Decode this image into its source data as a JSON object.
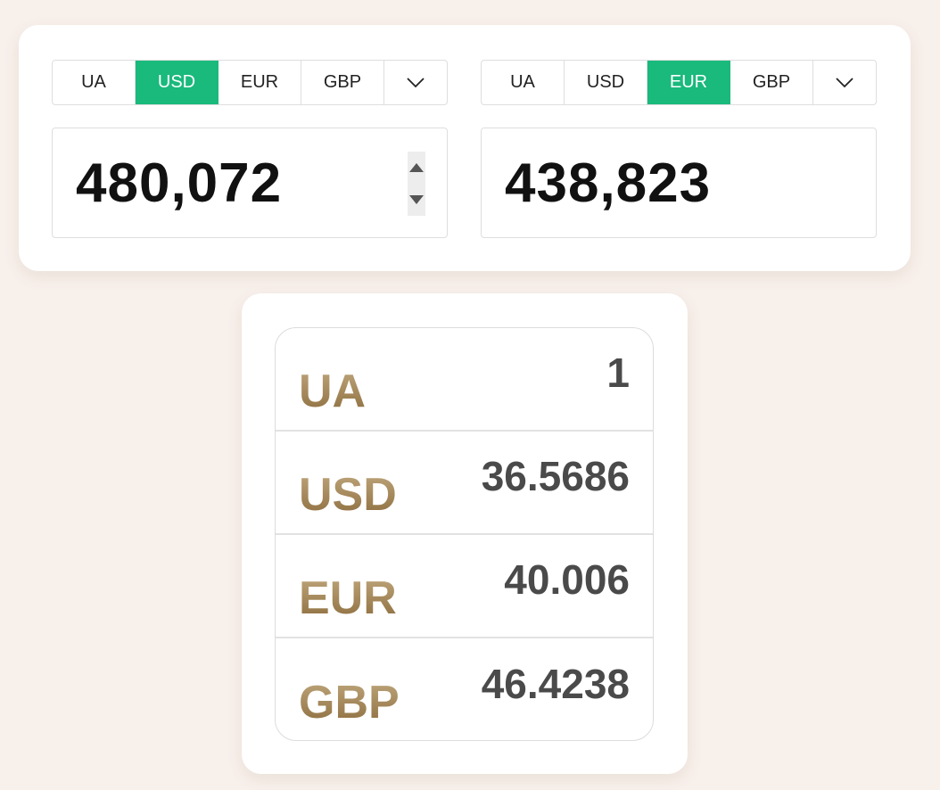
{
  "colors": {
    "page_background": "#f8f0eb",
    "card_background": "#ffffff",
    "accent": "#1ab97c",
    "rate_code_gradient": [
      "#c2aa80",
      "#8a6a3a"
    ],
    "rate_value": "#4a4a4a"
  },
  "converter": {
    "from": {
      "tabs": [
        "UA",
        "USD",
        "EUR",
        "GBP"
      ],
      "active_tab": "USD",
      "more_icon": "chevron-down-icon",
      "amount": "480,072"
    },
    "to": {
      "tabs": [
        "UA",
        "USD",
        "EUR",
        "GBP"
      ],
      "active_tab": "EUR",
      "more_icon": "chevron-down-icon",
      "amount": "438,823"
    }
  },
  "rates": [
    {
      "code": "UA",
      "value": "1"
    },
    {
      "code": "USD",
      "value": "36.5686"
    },
    {
      "code": "EUR",
      "value": "40.006"
    },
    {
      "code": "GBP",
      "value": "46.4238"
    }
  ]
}
